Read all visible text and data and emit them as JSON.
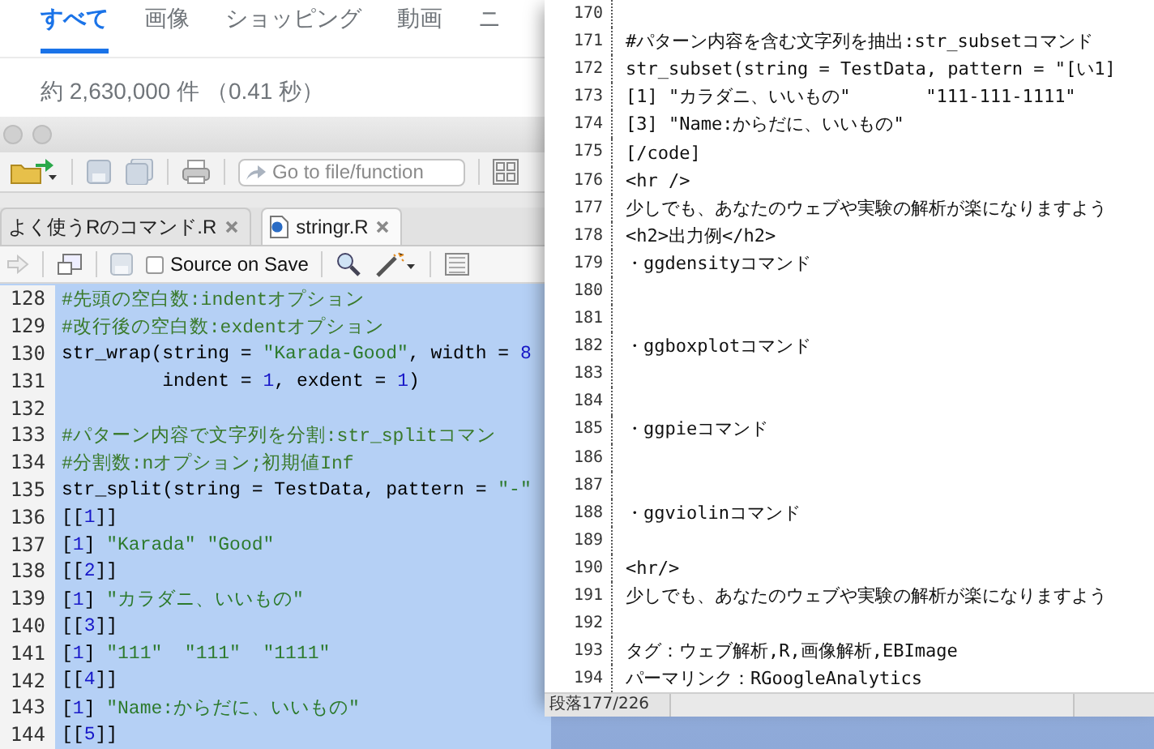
{
  "browser": {
    "tabs": [
      {
        "label": "すべて",
        "selected": true
      },
      {
        "label": "画像",
        "selected": false
      },
      {
        "label": "ショッピング",
        "selected": false
      },
      {
        "label": "動画",
        "selected": false
      },
      {
        "label": "ニ",
        "selected": false
      }
    ],
    "result_stats": "約 2,630,000 件 （0.41 秒）"
  },
  "rstudio": {
    "toolbar": {
      "search_placeholder": "Go to file/function"
    },
    "tabs": [
      {
        "label": "よく使うRのコマンド.R",
        "selected": false
      },
      {
        "label": "stringr.R",
        "selected": true
      }
    ],
    "source_on_save": {
      "label": "Source on Save",
      "checked": false
    },
    "lines": [
      {
        "number": "128",
        "segments": [
          {
            "kind": "comment",
            "text": "#先頭の空白数:indentオプション"
          }
        ]
      },
      {
        "number": "129",
        "segments": [
          {
            "kind": "comment",
            "text": "#改行後の空白数:exdentオプション"
          }
        ]
      },
      {
        "number": "130",
        "segments": [
          {
            "kind": "plain",
            "text": "str_wrap(string = "
          },
          {
            "kind": "string",
            "text": "\"Karada-Good\""
          },
          {
            "kind": "plain",
            "text": ", width = "
          },
          {
            "kind": "number",
            "text": "8"
          }
        ]
      },
      {
        "number": "131",
        "segments": [
          {
            "kind": "plain",
            "text": "         indent = "
          },
          {
            "kind": "number",
            "text": "1"
          },
          {
            "kind": "plain",
            "text": ", exdent = "
          },
          {
            "kind": "number",
            "text": "1"
          },
          {
            "kind": "plain",
            "text": ")"
          }
        ]
      },
      {
        "number": "132"
      },
      {
        "number": "133",
        "segments": [
          {
            "kind": "comment",
            "text": "#パターン内容で文字列を分割:str_splitコマン"
          }
        ]
      },
      {
        "number": "134",
        "segments": [
          {
            "kind": "comment",
            "text": "#分割数:nオプション;初期値Inf"
          }
        ]
      },
      {
        "number": "135",
        "segments": [
          {
            "kind": "plain",
            "text": "str_split(string = TestData, pattern = "
          },
          {
            "kind": "string",
            "text": "\"-\""
          }
        ]
      },
      {
        "number": "136",
        "segments": [
          {
            "kind": "plain",
            "text": "[["
          },
          {
            "kind": "number",
            "text": "1"
          },
          {
            "kind": "plain",
            "text": "]]"
          }
        ]
      },
      {
        "number": "137",
        "segments": [
          {
            "kind": "plain",
            "text": "["
          },
          {
            "kind": "number",
            "text": "1"
          },
          {
            "kind": "plain",
            "text": "] "
          },
          {
            "kind": "string",
            "text": "\"Karada\" \"Good\""
          }
        ]
      },
      {
        "number": "138",
        "segments": [
          {
            "kind": "plain",
            "text": "[["
          },
          {
            "kind": "number",
            "text": "2"
          },
          {
            "kind": "plain",
            "text": "]]"
          }
        ]
      },
      {
        "number": "139",
        "segments": [
          {
            "kind": "plain",
            "text": "["
          },
          {
            "kind": "number",
            "text": "1"
          },
          {
            "kind": "plain",
            "text": "] "
          },
          {
            "kind": "string",
            "text": "\"カラダニ、いいもの\""
          }
        ]
      },
      {
        "number": "140",
        "segments": [
          {
            "kind": "plain",
            "text": "[["
          },
          {
            "kind": "number",
            "text": "3"
          },
          {
            "kind": "plain",
            "text": "]]"
          }
        ]
      },
      {
        "number": "141",
        "segments": [
          {
            "kind": "plain",
            "text": "["
          },
          {
            "kind": "number",
            "text": "1"
          },
          {
            "kind": "plain",
            "text": "] "
          },
          {
            "kind": "string",
            "text": "\"111\"  \"111\"  \"1111\""
          }
        ]
      },
      {
        "number": "142",
        "segments": [
          {
            "kind": "plain",
            "text": "[["
          },
          {
            "kind": "number",
            "text": "4"
          },
          {
            "kind": "plain",
            "text": "]]"
          }
        ]
      },
      {
        "number": "143",
        "segments": [
          {
            "kind": "plain",
            "text": "["
          },
          {
            "kind": "number",
            "text": "1"
          },
          {
            "kind": "plain",
            "text": "] "
          },
          {
            "kind": "string",
            "text": "\"Name:からだに、いいもの\""
          }
        ]
      },
      {
        "number": "144",
        "segments": [
          {
            "kind": "plain",
            "text": "[["
          },
          {
            "kind": "number",
            "text": "5"
          },
          {
            "kind": "plain",
            "text": "]]"
          }
        ]
      }
    ]
  },
  "text_editor": {
    "lines": [
      {
        "number": "170"
      },
      {
        "number": "171",
        "text": "#パターン内容を含む文字列を抽出:str_subsetコマンド"
      },
      {
        "number": "172",
        "text": "str_subset(string = TestData, pattern = \"[い1]"
      },
      {
        "number": "173",
        "text": "[1] \"カラダニ、いいもの\"       \"111-111-1111\""
      },
      {
        "number": "174",
        "text": "[3] \"Name:からだに、いいもの\""
      },
      {
        "number": "175",
        "text": "[/code]"
      },
      {
        "number": "176",
        "text": "<hr />"
      },
      {
        "number": "177",
        "text": "少しでも、あなたのウェブや実験の解析が楽になりますよう"
      },
      {
        "number": "178",
        "text": "<h2>出力例</h2>"
      },
      {
        "number": "179",
        "text": "・ggdensityコマンド"
      },
      {
        "number": "180"
      },
      {
        "number": "181"
      },
      {
        "number": "182",
        "text": "・ggboxplotコマンド"
      },
      {
        "number": "183"
      },
      {
        "number": "184"
      },
      {
        "number": "185",
        "text": "・ggpieコマンド"
      },
      {
        "number": "186"
      },
      {
        "number": "187"
      },
      {
        "number": "188",
        "text": "・ggviolinコマンド"
      },
      {
        "number": "189"
      },
      {
        "number": "190",
        "text": "<hr/>"
      },
      {
        "number": "191",
        "text": "少しでも、あなたのウェブや実験の解析が楽になりますよう"
      },
      {
        "number": "192"
      },
      {
        "number": "193",
        "text": "タグ：ウェブ解析,R,画像解析,EBImage"
      },
      {
        "number": "194",
        "text": "パーマリンク：RGoogleAnalytics"
      }
    ],
    "status": "段落177/226"
  }
}
